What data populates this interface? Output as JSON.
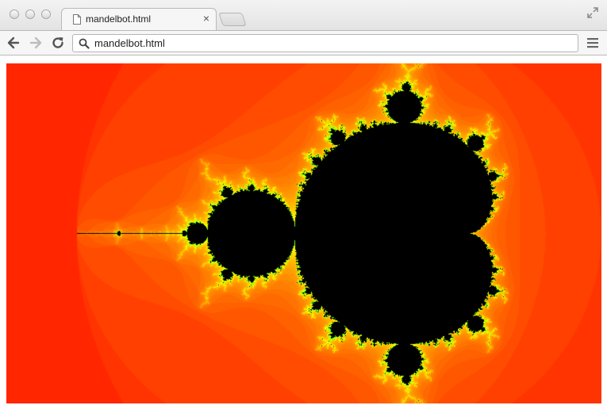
{
  "window": {
    "tab_title": "mandelbot.html",
    "tab_close_glyph": "×",
    "url": "mandelbot.html"
  },
  "icons": {
    "traffic_lights": [
      "close-light-icon",
      "minimize-light-icon",
      "zoom-light-icon"
    ],
    "tab": "document-icon",
    "fullscreen": "fullscreen-arrows-icon",
    "back": "back-arrow-icon",
    "forward": "forward-arrow-icon",
    "reload": "reload-icon",
    "search": "search-icon",
    "menu": "hamburger-menu-icon"
  },
  "canvas": {
    "description_free": true,
    "colors": {
      "background": "#ff1a00",
      "set": "#000000",
      "near": [
        "#ff3c00",
        "#ff6400",
        "#ff9600",
        "#ffc800",
        "#ffff00",
        "#9fff00",
        "#00ff40"
      ]
    },
    "view": {
      "xmin": -2.4,
      "xmax": 1.0,
      "ymin": -1.0,
      "ymax": 1.0
    },
    "max_iterations": 80
  }
}
